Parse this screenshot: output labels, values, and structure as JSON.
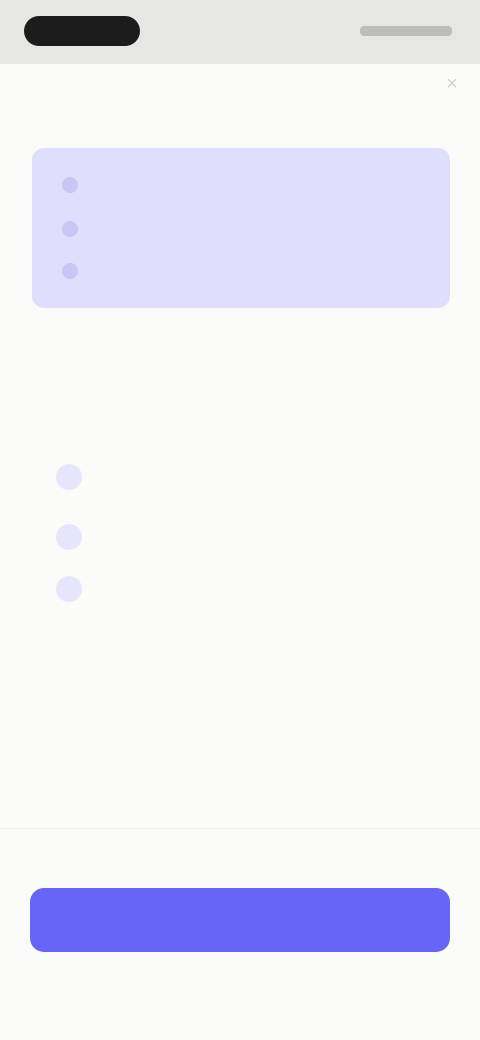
{
  "header": {
    "title": "",
    "close_icon": "close-icon"
  },
  "checklist": {
    "items": [
      {
        "label": "",
        "emphasized": true
      },
      {
        "label": ""
      },
      {
        "label": ""
      }
    ]
  },
  "info_section": {
    "title": "",
    "description": "",
    "features": [
      {
        "icon": "feature-icon",
        "label": ""
      },
      {
        "icon": "feature-icon",
        "label": ""
      },
      {
        "icon": "feature-icon",
        "label": ""
      }
    ]
  },
  "footer": {
    "primary_button_label": ""
  },
  "colors": {
    "accent": "#6765f8",
    "card_background": "#dfdefd",
    "page_background": "#fbfbfa"
  }
}
